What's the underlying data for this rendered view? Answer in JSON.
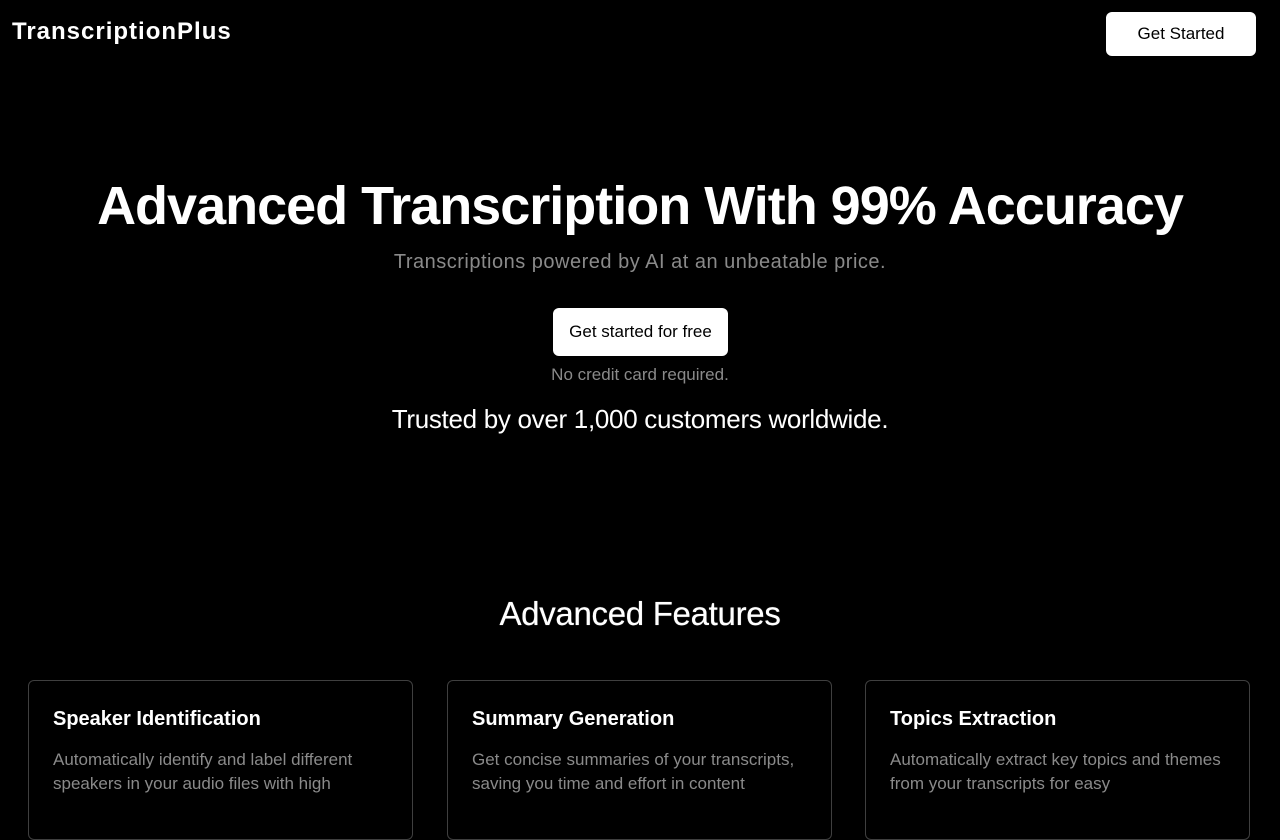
{
  "header": {
    "brand": "TranscriptionPlus",
    "cta_label": "Get Started"
  },
  "hero": {
    "title": "Advanced Transcription With 99% Accuracy",
    "subtitle": "Transcriptions powered by AI at an unbeatable price.",
    "cta_label": "Get started for free",
    "note": "No credit card required.",
    "trust": "Trusted by over 1,000 customers worldwide."
  },
  "features": {
    "title": "Advanced Features",
    "cards": [
      {
        "title": "Speaker Identification",
        "description": "Automatically identify and label different speakers in your audio files with high"
      },
      {
        "title": "Summary Generation",
        "description": "Get concise summaries of your transcripts, saving you time and effort in content"
      },
      {
        "title": "Topics Extraction",
        "description": "Automatically extract key topics and themes from your transcripts for easy"
      }
    ]
  },
  "colors": {
    "background": "#000000",
    "text": "#ffffff",
    "muted_text": "#8a8a8a",
    "button_bg": "#ffffff",
    "button_text": "#000000",
    "card_border": "#3f3f3f"
  }
}
